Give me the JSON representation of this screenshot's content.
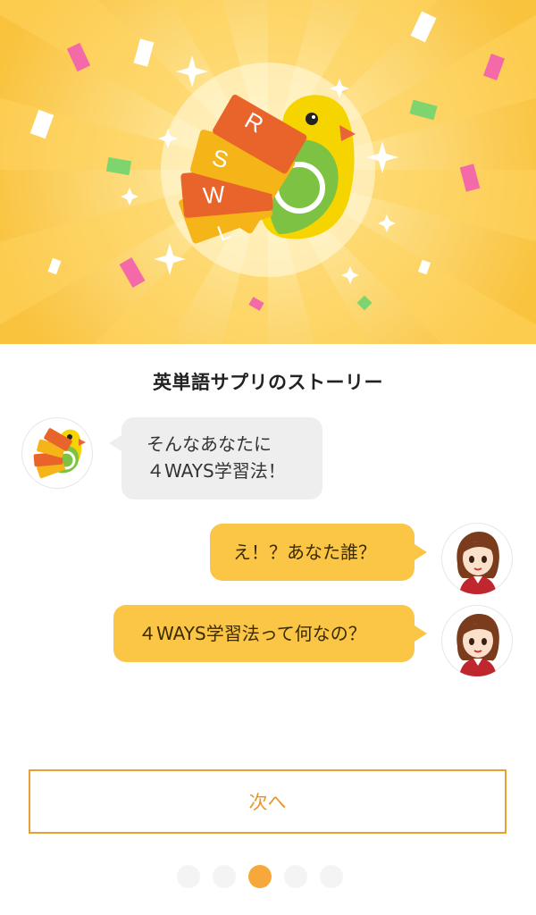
{
  "hero": {
    "letters": [
      "R",
      "S",
      "W",
      "L"
    ]
  },
  "story": {
    "title": "英単語サプリのストーリー"
  },
  "messages": [
    {
      "from": "bot",
      "lines": [
        "そんなあなたに",
        "４WAYS学習法！"
      ]
    },
    {
      "from": "user",
      "text": "え！？あなた誰？"
    },
    {
      "from": "user",
      "text": "４WAYS学習法って何なの？"
    }
  ],
  "actions": {
    "next_label": "次へ"
  },
  "pagination": {
    "total": 5,
    "current": 3
  },
  "colors": {
    "accent": "#f7a83a",
    "bubble_user": "#fbc545",
    "bubble_bot": "#eeeeee",
    "button_border": "#e8a030"
  }
}
